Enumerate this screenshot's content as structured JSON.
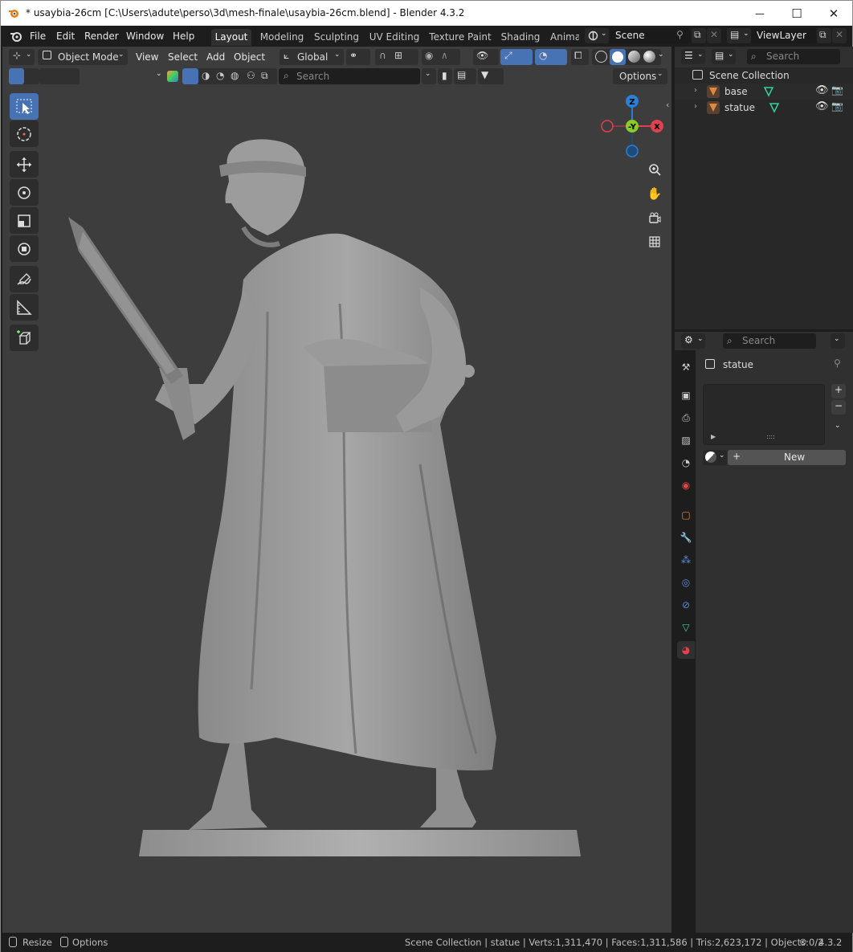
{
  "window": {
    "title": "* usaybia-26cm [C:\\Users\\adute\\perso\\3d\\mesh-finale\\usaybia-26cm.blend] - Blender 4.3.2",
    "minimize_glyph": "—",
    "maximize_glyph": "☐",
    "close_glyph": "✕"
  },
  "menu": {
    "items": [
      "File",
      "Edit",
      "Render",
      "Window",
      "Help"
    ]
  },
  "workspaces": {
    "tabs": [
      "Layout",
      "Modeling",
      "Sculpting",
      "UV Editing",
      "Texture Paint",
      "Shading",
      "Anima"
    ],
    "active": "Layout"
  },
  "scene": {
    "label": "Scene"
  },
  "view_layer": {
    "label": "ViewLayer"
  },
  "viewport_header": {
    "mode": "Object Mode",
    "menus": [
      "View",
      "Select",
      "Add",
      "Object"
    ],
    "orientation": "Global",
    "search_placeholder": "Search",
    "options_label": "Options"
  },
  "outliner": {
    "search_placeholder": "Search",
    "root": "Scene Collection",
    "items": [
      {
        "name": "base"
      },
      {
        "name": "statue"
      }
    ]
  },
  "properties": {
    "search_placeholder": "Search",
    "object_name": "statue",
    "new_button": "New",
    "plus": "+",
    "minus": "−"
  },
  "gizmo": {
    "z": "Z",
    "y": "-Y",
    "x": "X"
  },
  "statusbar": {
    "resize": "Resize",
    "options": "Options",
    "stats": "Scene Collection | statue | Verts:1,311,470 | Faces:1,311,586 | Tris:2,623,172 | Objects:0/2",
    "version": "4.3.2"
  },
  "colors": {
    "accent": "#4772b3",
    "header_bg": "#303030",
    "viewport_bg": "#3d3d3d",
    "mesh_orange": "#e08a3c",
    "gizmo_x": "#e0404f",
    "gizmo_y": "#8acb24",
    "gizmo_z": "#2a7fd6"
  }
}
